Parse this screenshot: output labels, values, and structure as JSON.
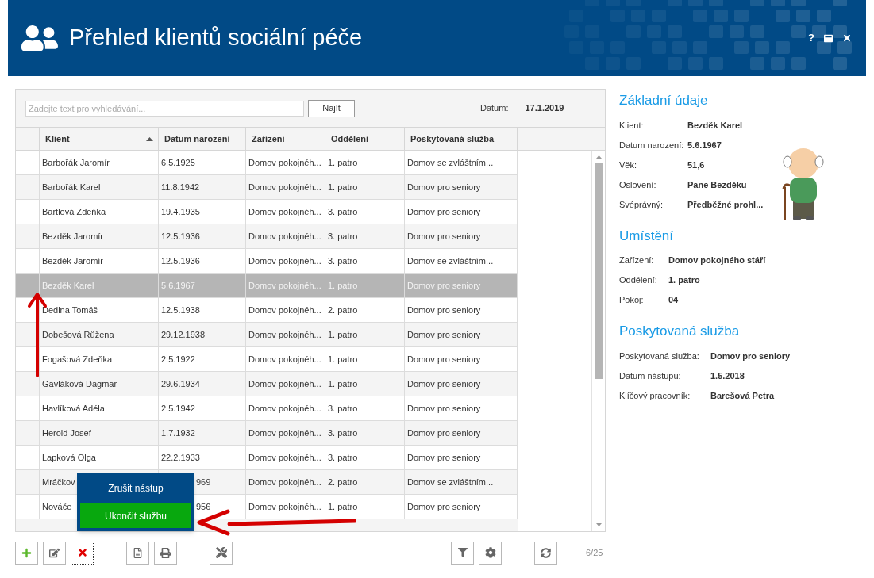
{
  "window": {
    "title": "Přehled klientů sociální péče",
    "help": "?"
  },
  "search": {
    "placeholder": "Zadejte text pro vyhledávání...",
    "button": "Najít",
    "date_label": "Datum:",
    "date_value": "17.1.2019"
  },
  "table": {
    "columns": [
      {
        "label": "Klient",
        "sorted_ascending": true
      },
      {
        "label": "Datum narození",
        "sorted_ascending": false
      },
      {
        "label": "Zařízení",
        "sorted_ascending": false
      },
      {
        "label": "Oddělení",
        "sorted_ascending": false
      },
      {
        "label": "Poskytovaná služba",
        "sorted_ascending": false
      }
    ],
    "rows": [
      {
        "cells": [
          "Barbořák Jaromír",
          "6.5.1925",
          "Domov pokojnéh...",
          "1. patro",
          "Domov se zvláštním..."
        ],
        "selected": false
      },
      {
        "cells": [
          "Barbořák Karel",
          "11.8.1942",
          "Domov pokojnéh...",
          "1. patro",
          "Domov pro seniory"
        ],
        "selected": false
      },
      {
        "cells": [
          "Bartlová Zdeňka",
          "19.4.1935",
          "Domov pokojnéh...",
          "3. patro",
          "Domov pro seniory"
        ],
        "selected": false
      },
      {
        "cells": [
          "Bezděk Jaromír",
          "12.5.1936",
          "Domov pokojnéh...",
          "3. patro",
          "Domov pro seniory"
        ],
        "selected": false
      },
      {
        "cells": [
          "Bezděk Jaromír",
          "12.5.1936",
          "Domov pokojnéh...",
          "3. patro",
          "Domov se zvláštním..."
        ],
        "selected": false
      },
      {
        "cells": [
          "Bezděk Karel",
          "5.6.1967",
          "Domov pokojnéh...",
          "1. patro",
          "Domov pro seniory"
        ],
        "selected": true
      },
      {
        "cells": [
          "Dedina Tomáš",
          "12.5.1938",
          "Domov pokojnéh...",
          "2. patro",
          "Domov pro seniory"
        ],
        "selected": false
      },
      {
        "cells": [
          "Dobešová Růžena",
          "29.12.1938",
          "Domov pokojnéh...",
          "1. patro",
          "Domov pro seniory"
        ],
        "selected": false
      },
      {
        "cells": [
          "Fogašová Zdeňka",
          "2.5.1922",
          "Domov pokojnéh...",
          "1. patro",
          "Domov pro seniory"
        ],
        "selected": false
      },
      {
        "cells": [
          "Gavláková Dagmar",
          "29.6.1934",
          "Domov pokojnéh...",
          "1. patro",
          "Domov pro seniory"
        ],
        "selected": false
      },
      {
        "cells": [
          "Havlíková Adéla",
          "2.5.1942",
          "Domov pokojnéh...",
          "3. patro",
          "Domov pro seniory"
        ],
        "selected": false
      },
      {
        "cells": [
          "Herold Josef",
          "1.7.1932",
          "Domov pokojnéh...",
          "3. patro",
          "Domov pro seniory"
        ],
        "selected": false
      },
      {
        "cells": [
          "Lapková Olga",
          "22.2.1933",
          "Domov pokojnéh...",
          "3. patro",
          "Domov pro seniory"
        ],
        "selected": false
      },
      {
        "cells": [
          "Mráčkov",
          "969",
          "Domov pokojnéh...",
          "2. patro",
          "Domov se zvláštním..."
        ],
        "selected": false,
        "covered": true
      },
      {
        "cells": [
          "Nováče",
          "956",
          "Domov pokojnéh...",
          "1. patro",
          "Domov pro seniory"
        ],
        "selected": false,
        "covered": true
      }
    ]
  },
  "popup_menu": {
    "items": [
      {
        "label": "Zrušit nástup",
        "highlighted": false
      },
      {
        "label": "Ukončit službu",
        "highlighted": true
      }
    ]
  },
  "pager": "6/25",
  "details": [
    {
      "title": "Základní údaje",
      "fields": [
        {
          "label": "Klient:",
          "value": "Bezděk Karel"
        },
        {
          "label": "Datum narození:",
          "value": "5.6.1967"
        },
        {
          "label": "Věk:",
          "value": "51,6"
        },
        {
          "label": "Oslovení:",
          "value": "Pane Bezděku"
        },
        {
          "label": "Svéprávný:",
          "value": "Předběžné prohl..."
        }
      ]
    },
    {
      "title": "Umístění",
      "fields": [
        {
          "label": "Zařízení:",
          "value": "Domov pokojného stáří"
        },
        {
          "label": "Oddělení:",
          "value": "1. patro"
        },
        {
          "label": "Pokoj:",
          "value": "04"
        }
      ]
    },
    {
      "title": "Poskytovaná služba",
      "fields": [
        {
          "label": "Poskytovaná služba:",
          "value": "Domov pro seniory"
        },
        {
          "label": "Datum nástupu:",
          "value": "1.5.2018"
        },
        {
          "label": "Klíčový pracovník:",
          "value": "Barešová Petra"
        }
      ]
    }
  ]
}
